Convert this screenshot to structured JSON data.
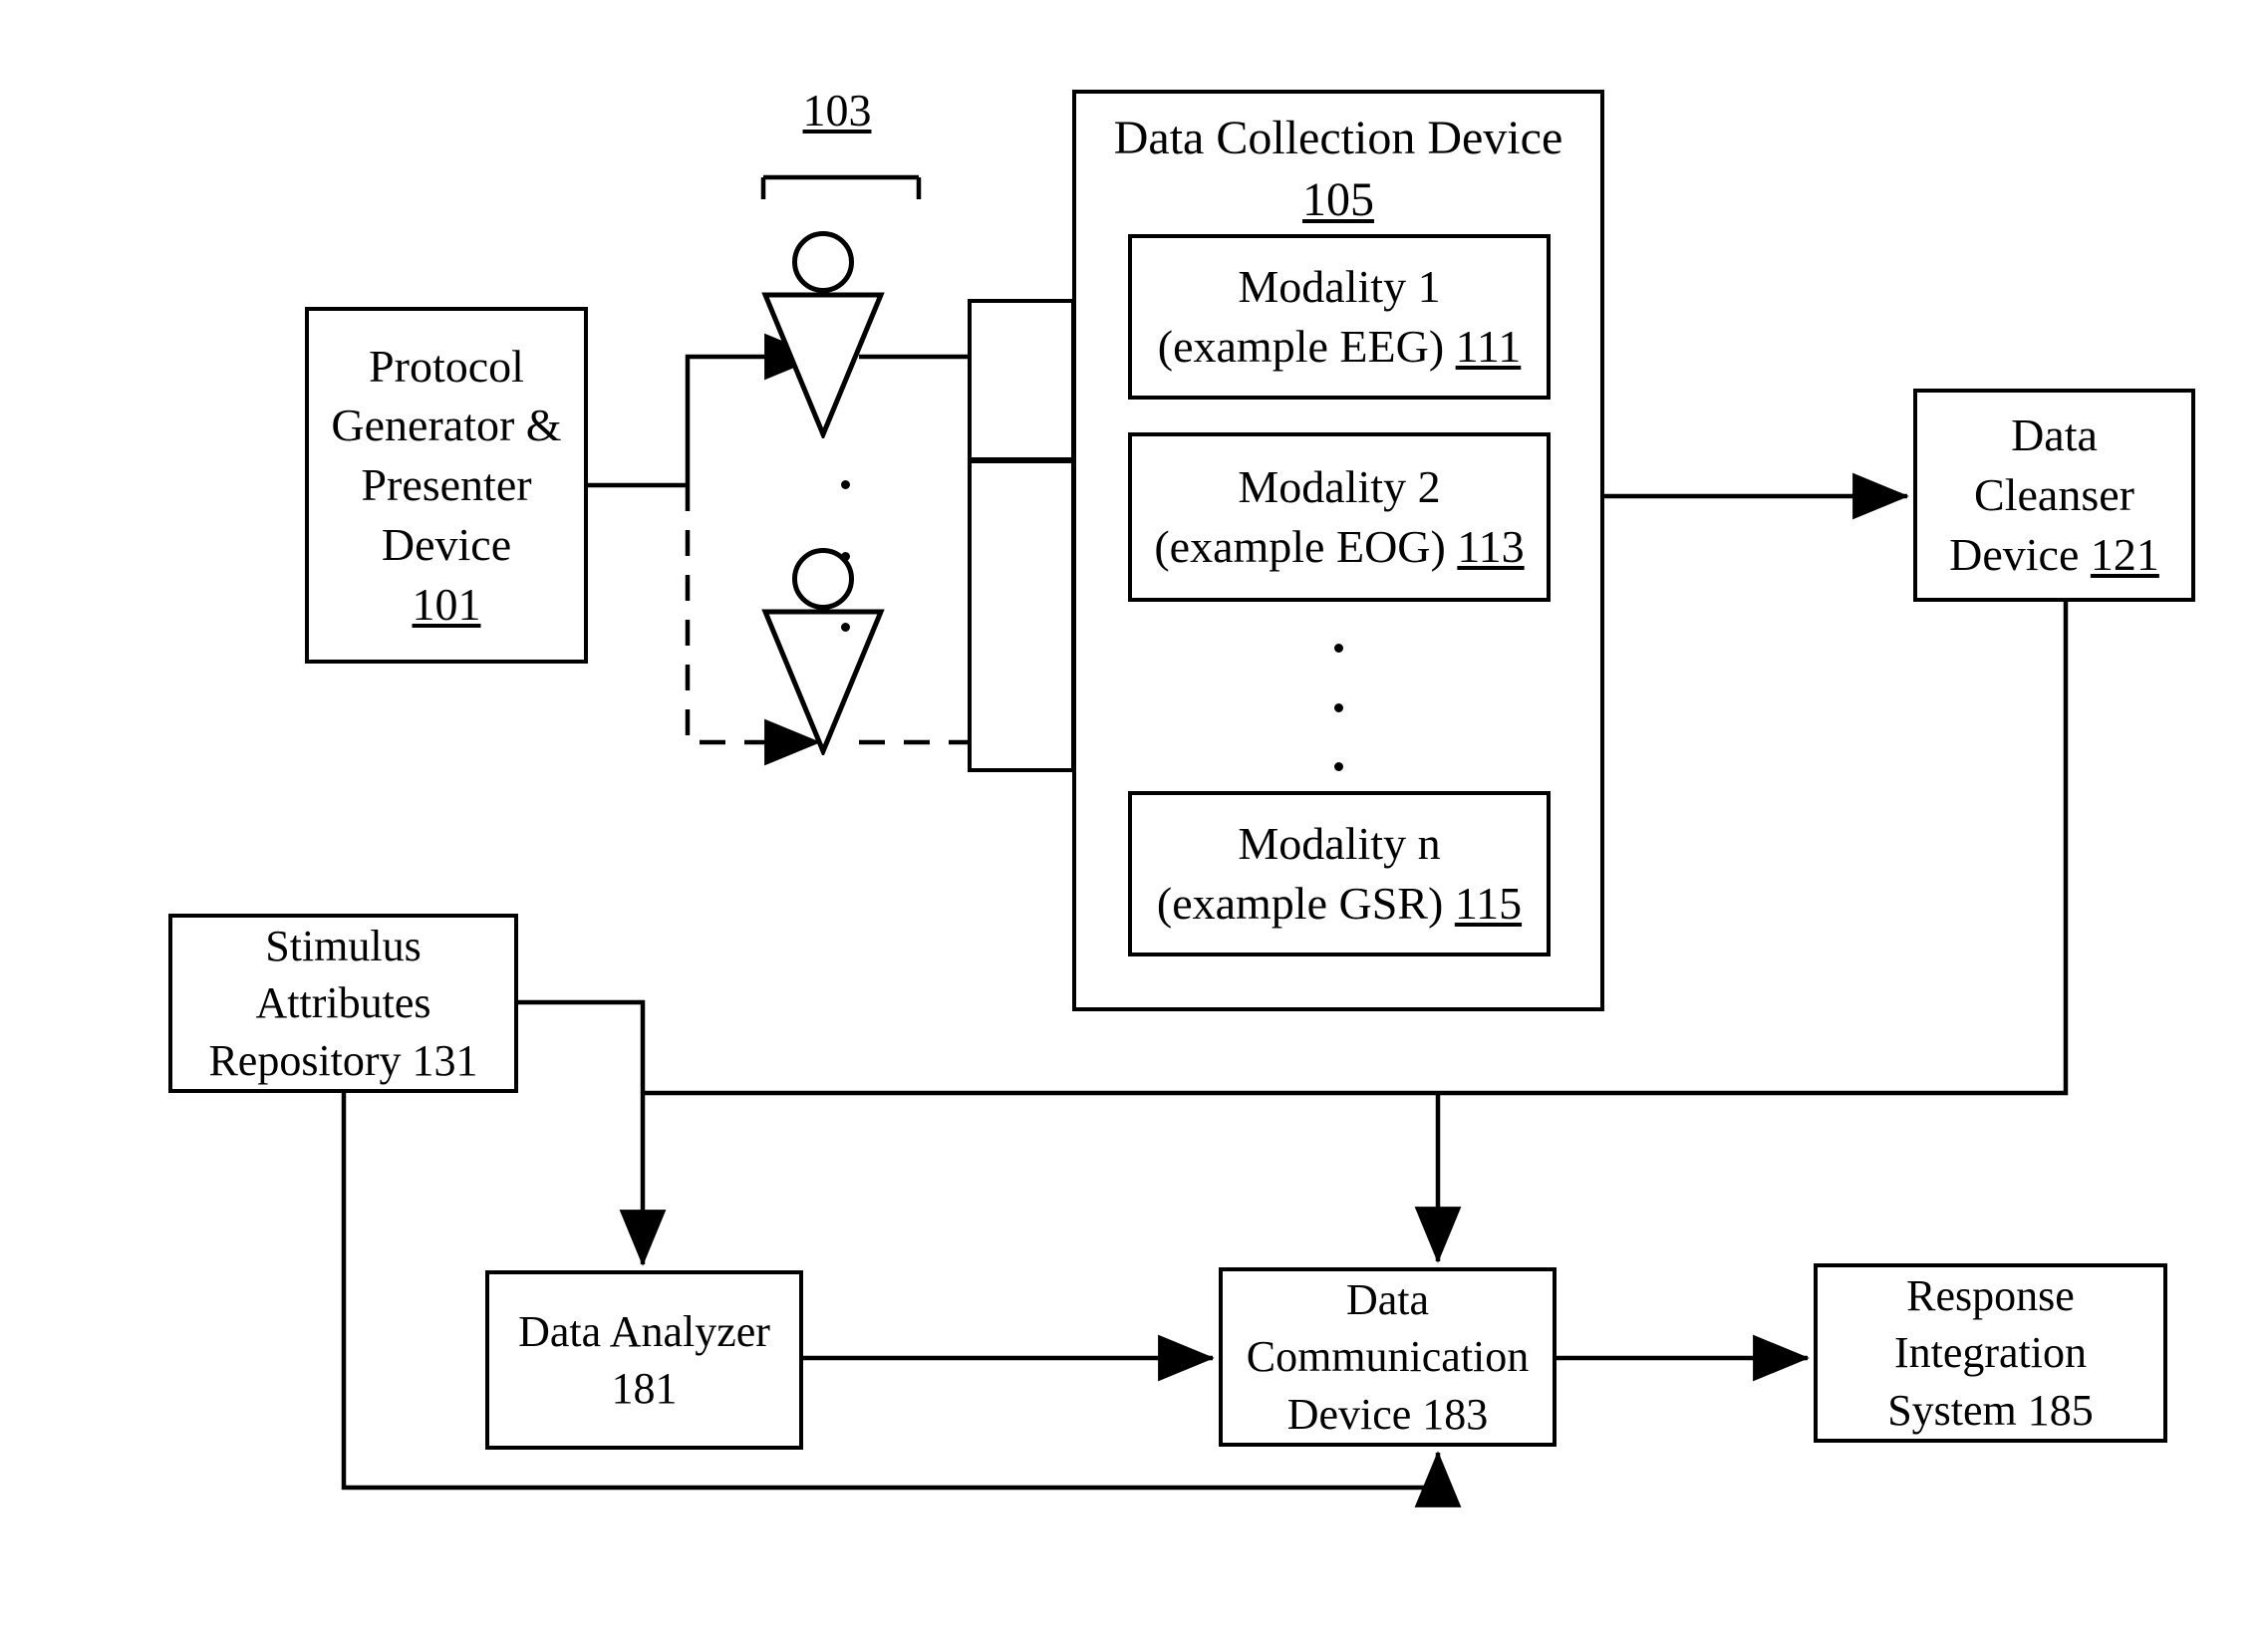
{
  "figure": {
    "type": "patent-block-diagram",
    "reference_103": "103"
  },
  "blocks": {
    "protocol_generator": {
      "id": "101",
      "lines": [
        "Protocol",
        "Generator &",
        "Presenter",
        "Device"
      ],
      "numeral": "101",
      "numeral_underlined": true
    },
    "data_collection_device": {
      "id": "105",
      "title": "Data Collection Device",
      "numeral": "105",
      "numeral_underlined": true,
      "modalities": [
        {
          "id": "111",
          "line1": "Modality 1",
          "line2_prefix": "(example EEG)",
          "numeral": "111",
          "numeral_underlined": true
        },
        {
          "id": "113",
          "line1": "Modality 2",
          "line2_prefix": "(example EOG)",
          "numeral": "113",
          "numeral_underlined": true
        },
        {
          "id": "115",
          "line1": "Modality n",
          "line2_prefix": "(example GSR)",
          "numeral": "115",
          "numeral_underlined": true
        }
      ]
    },
    "data_cleanser_device": {
      "id": "121",
      "line1": "Data",
      "line2": "Cleanser",
      "line3_prefix": "Device",
      "numeral": "121",
      "numeral_underlined": true
    },
    "stimulus_attributes_repository": {
      "id": "131",
      "line1": "Stimulus",
      "line2": "Attributes",
      "line3": "Repository 131",
      "numeral": "131",
      "numeral_underlined": false
    },
    "data_analyzer": {
      "id": "181",
      "line1": "Data Analyzer",
      "line2": "181",
      "numeral": "181",
      "numeral_underlined": false
    },
    "data_communication_device": {
      "id": "183",
      "line1": "Data",
      "line2": "Communication",
      "line3": "Device 183",
      "numeral": "183",
      "numeral_underlined": false
    },
    "response_integration_system": {
      "id": "185",
      "line1": "Response",
      "line2": "Integration",
      "line3": "System 185",
      "numeral": "185",
      "numeral_underlined": false
    }
  },
  "participants": {
    "group_label": "103",
    "count_shown": 2,
    "ellipsis_dots": 3,
    "icon": "person-icon"
  },
  "colors": {
    "stroke": "#000000",
    "background": "#ffffff",
    "text": "#000000"
  },
  "connections": [
    {
      "from": "101",
      "to": "participant-1",
      "style": "solid",
      "arrow": true
    },
    {
      "from": "101",
      "to": "participant-n",
      "style": "dashed",
      "arrow": true
    },
    {
      "from": "participant-1",
      "to": "105",
      "style": "solid",
      "arrow": false
    },
    {
      "from": "participant-n",
      "to": "105",
      "style": "dashed",
      "arrow": false
    },
    {
      "from": "105",
      "to": "121",
      "style": "solid",
      "arrow": true
    },
    {
      "from": "121",
      "to": "183",
      "style": "solid",
      "arrow": true
    },
    {
      "from": "131",
      "to": "181",
      "style": "solid",
      "arrow": true
    },
    {
      "from": "131",
      "to": "183",
      "style": "solid",
      "arrow": true
    },
    {
      "from": "181",
      "to": "183",
      "style": "solid",
      "arrow": true
    },
    {
      "from": "183",
      "to": "185",
      "style": "solid",
      "arrow": true
    }
  ]
}
